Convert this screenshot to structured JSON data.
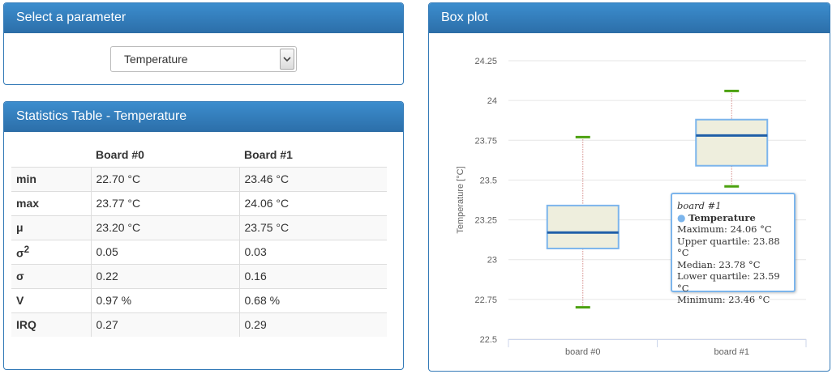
{
  "select_panel": {
    "title": "Select a parameter",
    "selected": "Temperature"
  },
  "stats_panel": {
    "title": "Statistics Table - Temperature",
    "columns": [
      "Board #0",
      "Board #1"
    ],
    "rows": [
      {
        "label": "min",
        "label_sup": "",
        "v0": "22.70 °C",
        "v1": "23.46 °C"
      },
      {
        "label": "max",
        "label_sup": "",
        "v0": "23.77 °C",
        "v1": "24.06 °C"
      },
      {
        "label": "μ",
        "label_sup": "",
        "v0": "23.20 °C",
        "v1": "23.75 °C"
      },
      {
        "label": "σ",
        "label_sup": "2",
        "v0": "0.05",
        "v1": "0.03"
      },
      {
        "label": "σ",
        "label_sup": "",
        "v0": "0.22",
        "v1": "0.16"
      },
      {
        "label": "V",
        "label_sup": "",
        "v0": "0.97 %",
        "v1": "0.68 %"
      },
      {
        "label": "IRQ",
        "label_sup": "",
        "v0": "0.27",
        "v1": "0.29"
      }
    ]
  },
  "box_panel": {
    "title": "Box plot"
  },
  "tooltip": {
    "title": "board #1",
    "series": "Temperature",
    "lines": [
      "Maximum: 24.06 °C",
      "Upper quartile: 23.88 °C",
      "Median: 23.78 °C",
      "Lower quartile: 23.59 °C",
      "Minimum: 23.46 °C"
    ]
  },
  "chart_data": {
    "type": "boxplot",
    "ylabel": "Temperature [°C]",
    "categories": [
      "board #0",
      "board #1"
    ],
    "ylim": [
      22.5,
      24.25
    ],
    "yticks": [
      "22.5",
      "22.75",
      "23",
      "23.25",
      "23.5",
      "23.75",
      "24",
      "24.25"
    ],
    "grid": true,
    "series": [
      {
        "name": "Temperature",
        "boxes": [
          {
            "category": "board #0",
            "min": 22.7,
            "q1": 23.07,
            "median": 23.17,
            "q3": 23.34,
            "max": 23.77
          },
          {
            "category": "board #1",
            "min": 23.46,
            "q1": 23.59,
            "median": 23.78,
            "q3": 23.88,
            "max": 24.06
          }
        ]
      }
    ],
    "colors": {
      "box_fill": "#eeeedd",
      "box_stroke": "#7cb5ec",
      "median": "#1f5fa8",
      "whisker_cap": "#4ca10f",
      "stem": "#c0504d",
      "grid": "#e6e6e6"
    }
  }
}
